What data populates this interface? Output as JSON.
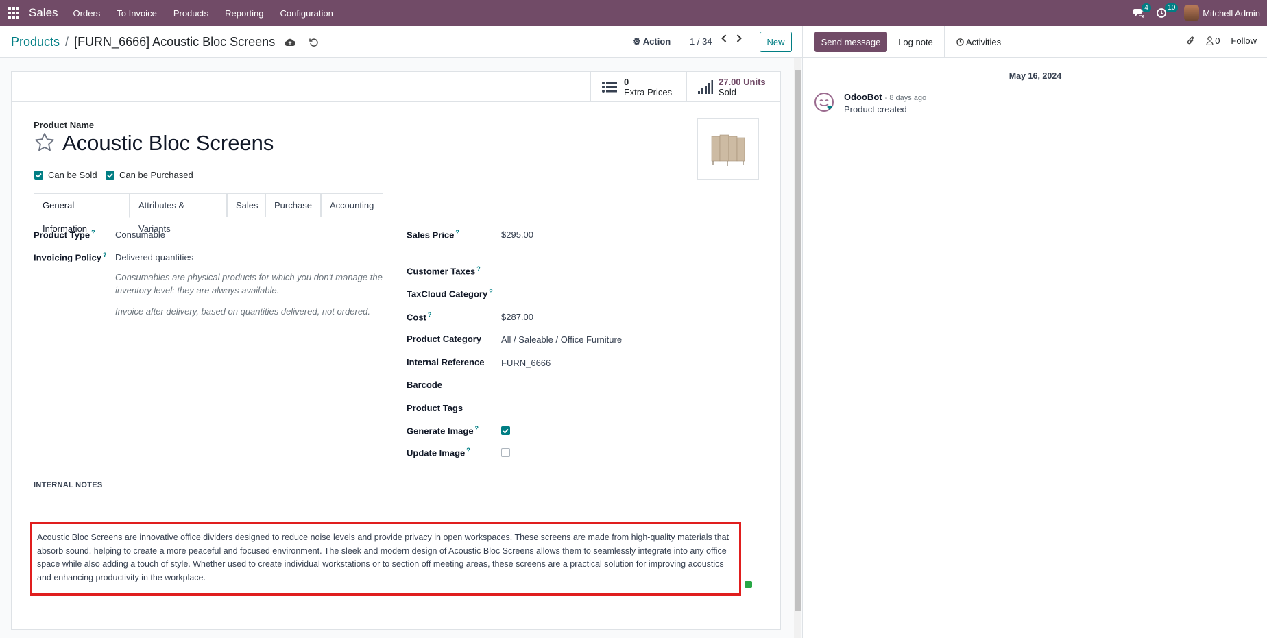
{
  "navbar": {
    "app_name": "Sales",
    "menu": [
      "Orders",
      "To Invoice",
      "Products",
      "Reporting",
      "Configuration"
    ],
    "messages_count": "4",
    "activities_count": "10",
    "user_name": "Mitchell Admin"
  },
  "control": {
    "breadcrumb_parent": "Products",
    "breadcrumb_separator": "/",
    "breadcrumb_current": "[FURN_6666] Acoustic Bloc Screens",
    "action_label": "Action",
    "pager": "1 / 34",
    "new_label": "New"
  },
  "stats": {
    "extra_prices_count": "0",
    "extra_prices_label": "Extra Prices",
    "sold_value": "27.00 Units",
    "sold_label": "Sold"
  },
  "product": {
    "name_label": "Product Name",
    "name": "Acoustic Bloc Screens",
    "can_be_sold_label": "Can be Sold",
    "can_be_purchased_label": "Can be Purchased"
  },
  "tabs": [
    "General Information",
    "Attributes & Variants",
    "Sales",
    "Purchase",
    "Accounting"
  ],
  "general": {
    "product_type_label": "Product Type",
    "product_type": "Consumable",
    "invoicing_policy_label": "Invoicing Policy",
    "invoicing_policy": "Delivered quantities",
    "help_consumable": "Consumables are physical products for which you don't manage the inventory level: they are always available.",
    "help_invoice": "Invoice after delivery, based on quantities delivered, not ordered.",
    "sales_price_label": "Sales Price",
    "sales_price": "$295.00",
    "customer_taxes_label": "Customer Taxes",
    "taxcloud_label": "TaxCloud Category",
    "cost_label": "Cost",
    "cost": "$287.00",
    "category_label": "Product Category",
    "category": "All / Saleable / Office Furniture",
    "internal_ref_label": "Internal Reference",
    "internal_ref": "FURN_6666",
    "barcode_label": "Barcode",
    "tags_label": "Product Tags",
    "generate_image_label": "Generate Image",
    "update_image_label": "Update Image",
    "help_marker": "?"
  },
  "notes": {
    "label": "INTERNAL NOTES",
    "text": "Acoustic Bloc Screens are innovative office dividers designed to reduce noise levels and provide privacy in open workspaces. These screens are made from high-quality materials that absorb sound, helping to create a more peaceful and focused environment. The sleek and modern design of Acoustic Bloc Screens allows them to seamlessly integrate into any office space while also adding a touch of style. Whether used to create individual workstations or to section off meeting areas, these screens are a practical solution for improving acoustics and enhancing productivity in the workplace."
  },
  "chatter": {
    "send_message": "Send message",
    "log_note": "Log note",
    "activities": "Activities",
    "followers_count": "0",
    "follow": "Follow",
    "date": "May 16, 2024",
    "author": "OdooBot",
    "time": "- 8 days ago",
    "body": "Product created"
  },
  "colors": {
    "brand": "#714b67",
    "accent": "#017e84",
    "highlight": "#e01e1e"
  }
}
